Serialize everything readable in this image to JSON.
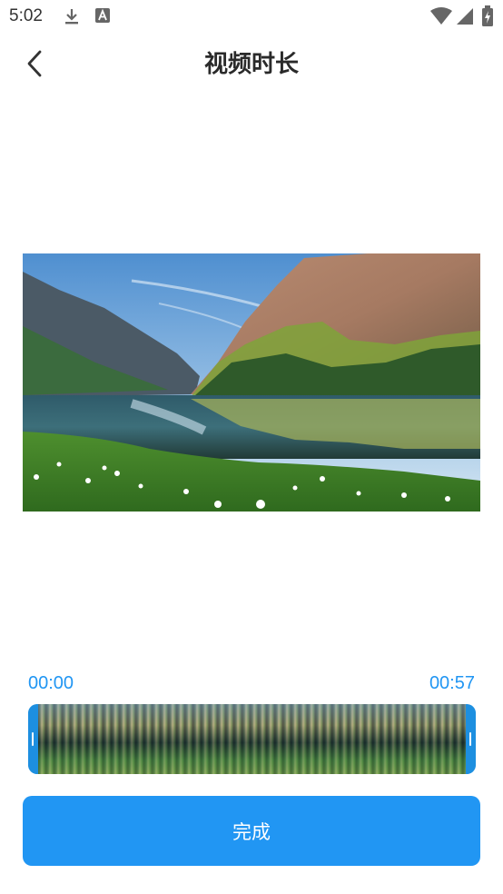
{
  "status_bar": {
    "time": "5:02",
    "icons": [
      "download-icon",
      "a-notification-icon",
      "wifi-icon",
      "signal-icon",
      "battery-icon"
    ]
  },
  "header": {
    "title": "视频时长",
    "back_icon": "back-arrow-icon"
  },
  "trimmer": {
    "start_time": "00:00",
    "end_time": "00:57"
  },
  "done_button": {
    "label": "完成"
  },
  "colors": {
    "accent": "#2196f3",
    "trim_track": "#1d8fe0",
    "title_text": "#2a2a2a"
  }
}
